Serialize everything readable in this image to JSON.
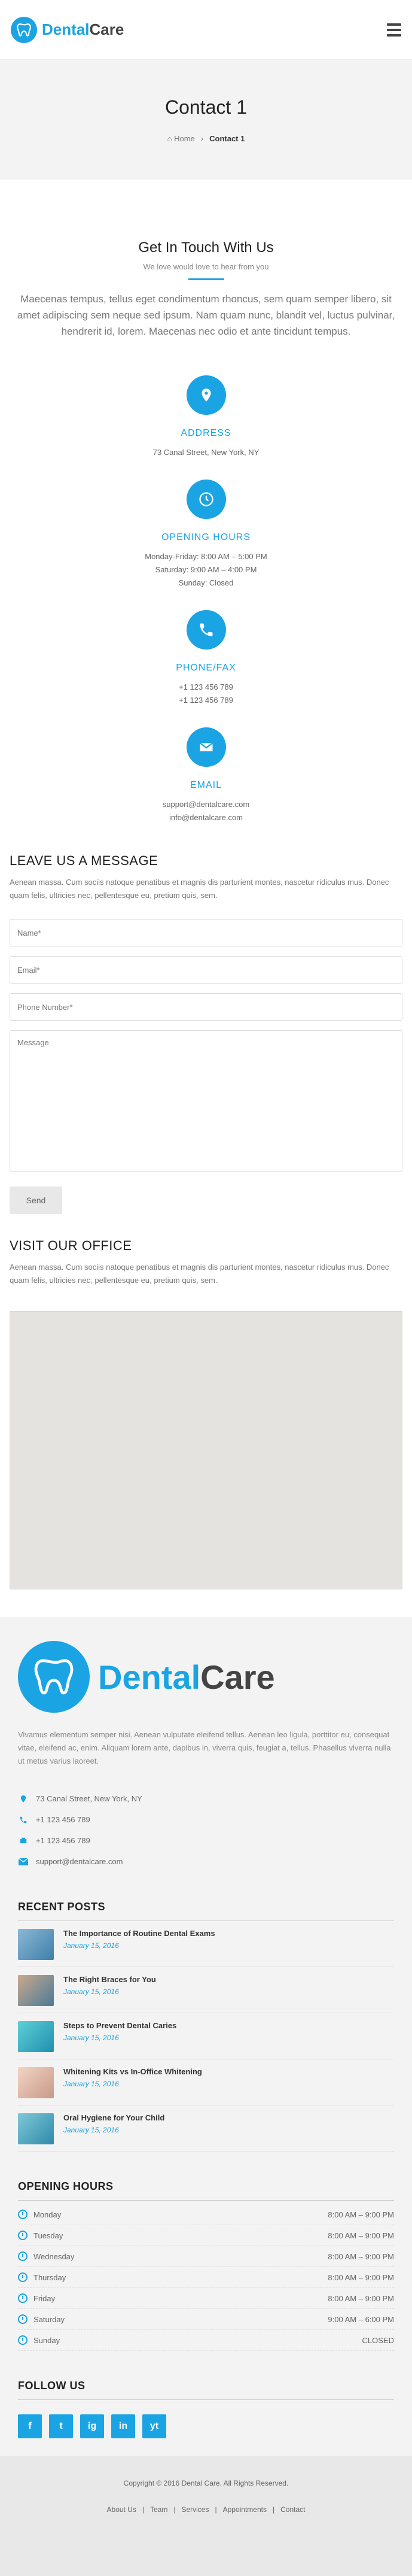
{
  "header": {
    "brand_first": "Dental",
    "brand_second": "Care"
  },
  "page_title": {
    "title": "Contact 1",
    "crumb_home": "Home",
    "crumb_current": "Contact 1"
  },
  "touch": {
    "title": "Get In Touch With Us",
    "subtitle": "We love would love to hear from you",
    "lead": "Maecenas tempus, tellus eget condimentum rhoncus, sem quam semper libero, sit amet adipiscing sem neque sed ipsum. Nam quam nunc, blandit vel, luctus pulvinar, hendrerit id, lorem. Maecenas nec odio et ante tincidunt tempus."
  },
  "info": {
    "address_title": "ADDRESS",
    "address": "73 Canal Street, New York, NY",
    "hours_title": "OPENING HOURS",
    "hours_1": "Monday-Friday: 8:00 AM – 5:00 PM",
    "hours_2": "Saturday: 9:00 AM – 4:00 PM",
    "hours_3": "Sunday: Closed",
    "phone_title": "PHONE/FAX",
    "phone_1": "+1 123 456 789",
    "phone_2": "+1 123 456 789",
    "email_title": "EMAIL",
    "email_1": "support@dentalcare.com",
    "email_2": "info@dentalcare.com"
  },
  "message": {
    "title": "LEAVE US A MESSAGE",
    "desc": "Aenean massa. Cum sociis natoque penatibus et magnis dis parturient montes, nascetur ridiculus mus. Donec quam felis, ultricies nec, pellentesque eu, pretium quis, sem.",
    "name_placeholder": "Name*",
    "email_placeholder": "Email*",
    "phone_placeholder": "Phone Number*",
    "message_placeholder": "Message",
    "send_label": "Send"
  },
  "office": {
    "title": "VISIT OUR OFFICE",
    "desc": "Aenean massa. Cum sociis natoque penatibus et magnis dis parturient montes, nascetur ridiculus mus. Donec quam felis, ultricies nec, pellentesque eu, pretium quis, sem."
  },
  "footer": {
    "brand_first": "Dental",
    "brand_second": "Care",
    "desc": "Vivamus elementum semper nisi. Aenean vulputate eleifend tellus. Aenean leo ligula, porttitor eu, consequat vitae, eleifend ac, enim. Aliquam lorem ante, dapibus in, viverra quis, feugiat a, tellus. Phasellus viverra nulla ut metus varius laoreet.",
    "contact_address": "73 Canal Street, New York, NY",
    "contact_phone": "+1 123 456 789",
    "contact_fax": "+1 123 456 789",
    "contact_email": "support@dentalcare.com",
    "recent_title": "RECENT POSTS",
    "posts": [
      {
        "title": "The Importance of Routine Dental Exams",
        "date": "January 15, 2016"
      },
      {
        "title": "The Right Braces for You",
        "date": "January 15, 2016"
      },
      {
        "title": "Steps to Prevent Dental Caries",
        "date": "January 15, 2016"
      },
      {
        "title": "Whitening Kits vs In-Office Whitening",
        "date": "January 15, 2016"
      },
      {
        "title": "Oral Hygiene for Your Child",
        "date": "January 15, 2016"
      }
    ],
    "hours_title": "OPENING HOURS",
    "hours": [
      {
        "day": "Monday",
        "time": "8:00 AM – 9:00 PM"
      },
      {
        "day": "Tuesday",
        "time": "8:00 AM – 9:00 PM"
      },
      {
        "day": "Wednesday",
        "time": "8:00 AM – 9:00 PM"
      },
      {
        "day": "Thursday",
        "time": "8:00 AM – 9:00 PM"
      },
      {
        "day": "Friday",
        "time": "8:00 AM – 9:00 PM"
      },
      {
        "day": "Saturday",
        "time": "9:00 AM – 6:00 PM"
      },
      {
        "day": "Sunday",
        "time": "CLOSED"
      }
    ],
    "follow_title": "FOLLOW US",
    "social": [
      "f",
      "t",
      "ig",
      "in",
      "yt"
    ]
  },
  "bottom": {
    "copyright": "Copyright © 2016 Dental Care. All Rights Reserved.",
    "links": [
      "About Us",
      "Team",
      "Services",
      "Appointments",
      "Contact"
    ]
  },
  "colors": {
    "accent": "#1ba4e3",
    "light_bg": "#f3f3f3"
  }
}
